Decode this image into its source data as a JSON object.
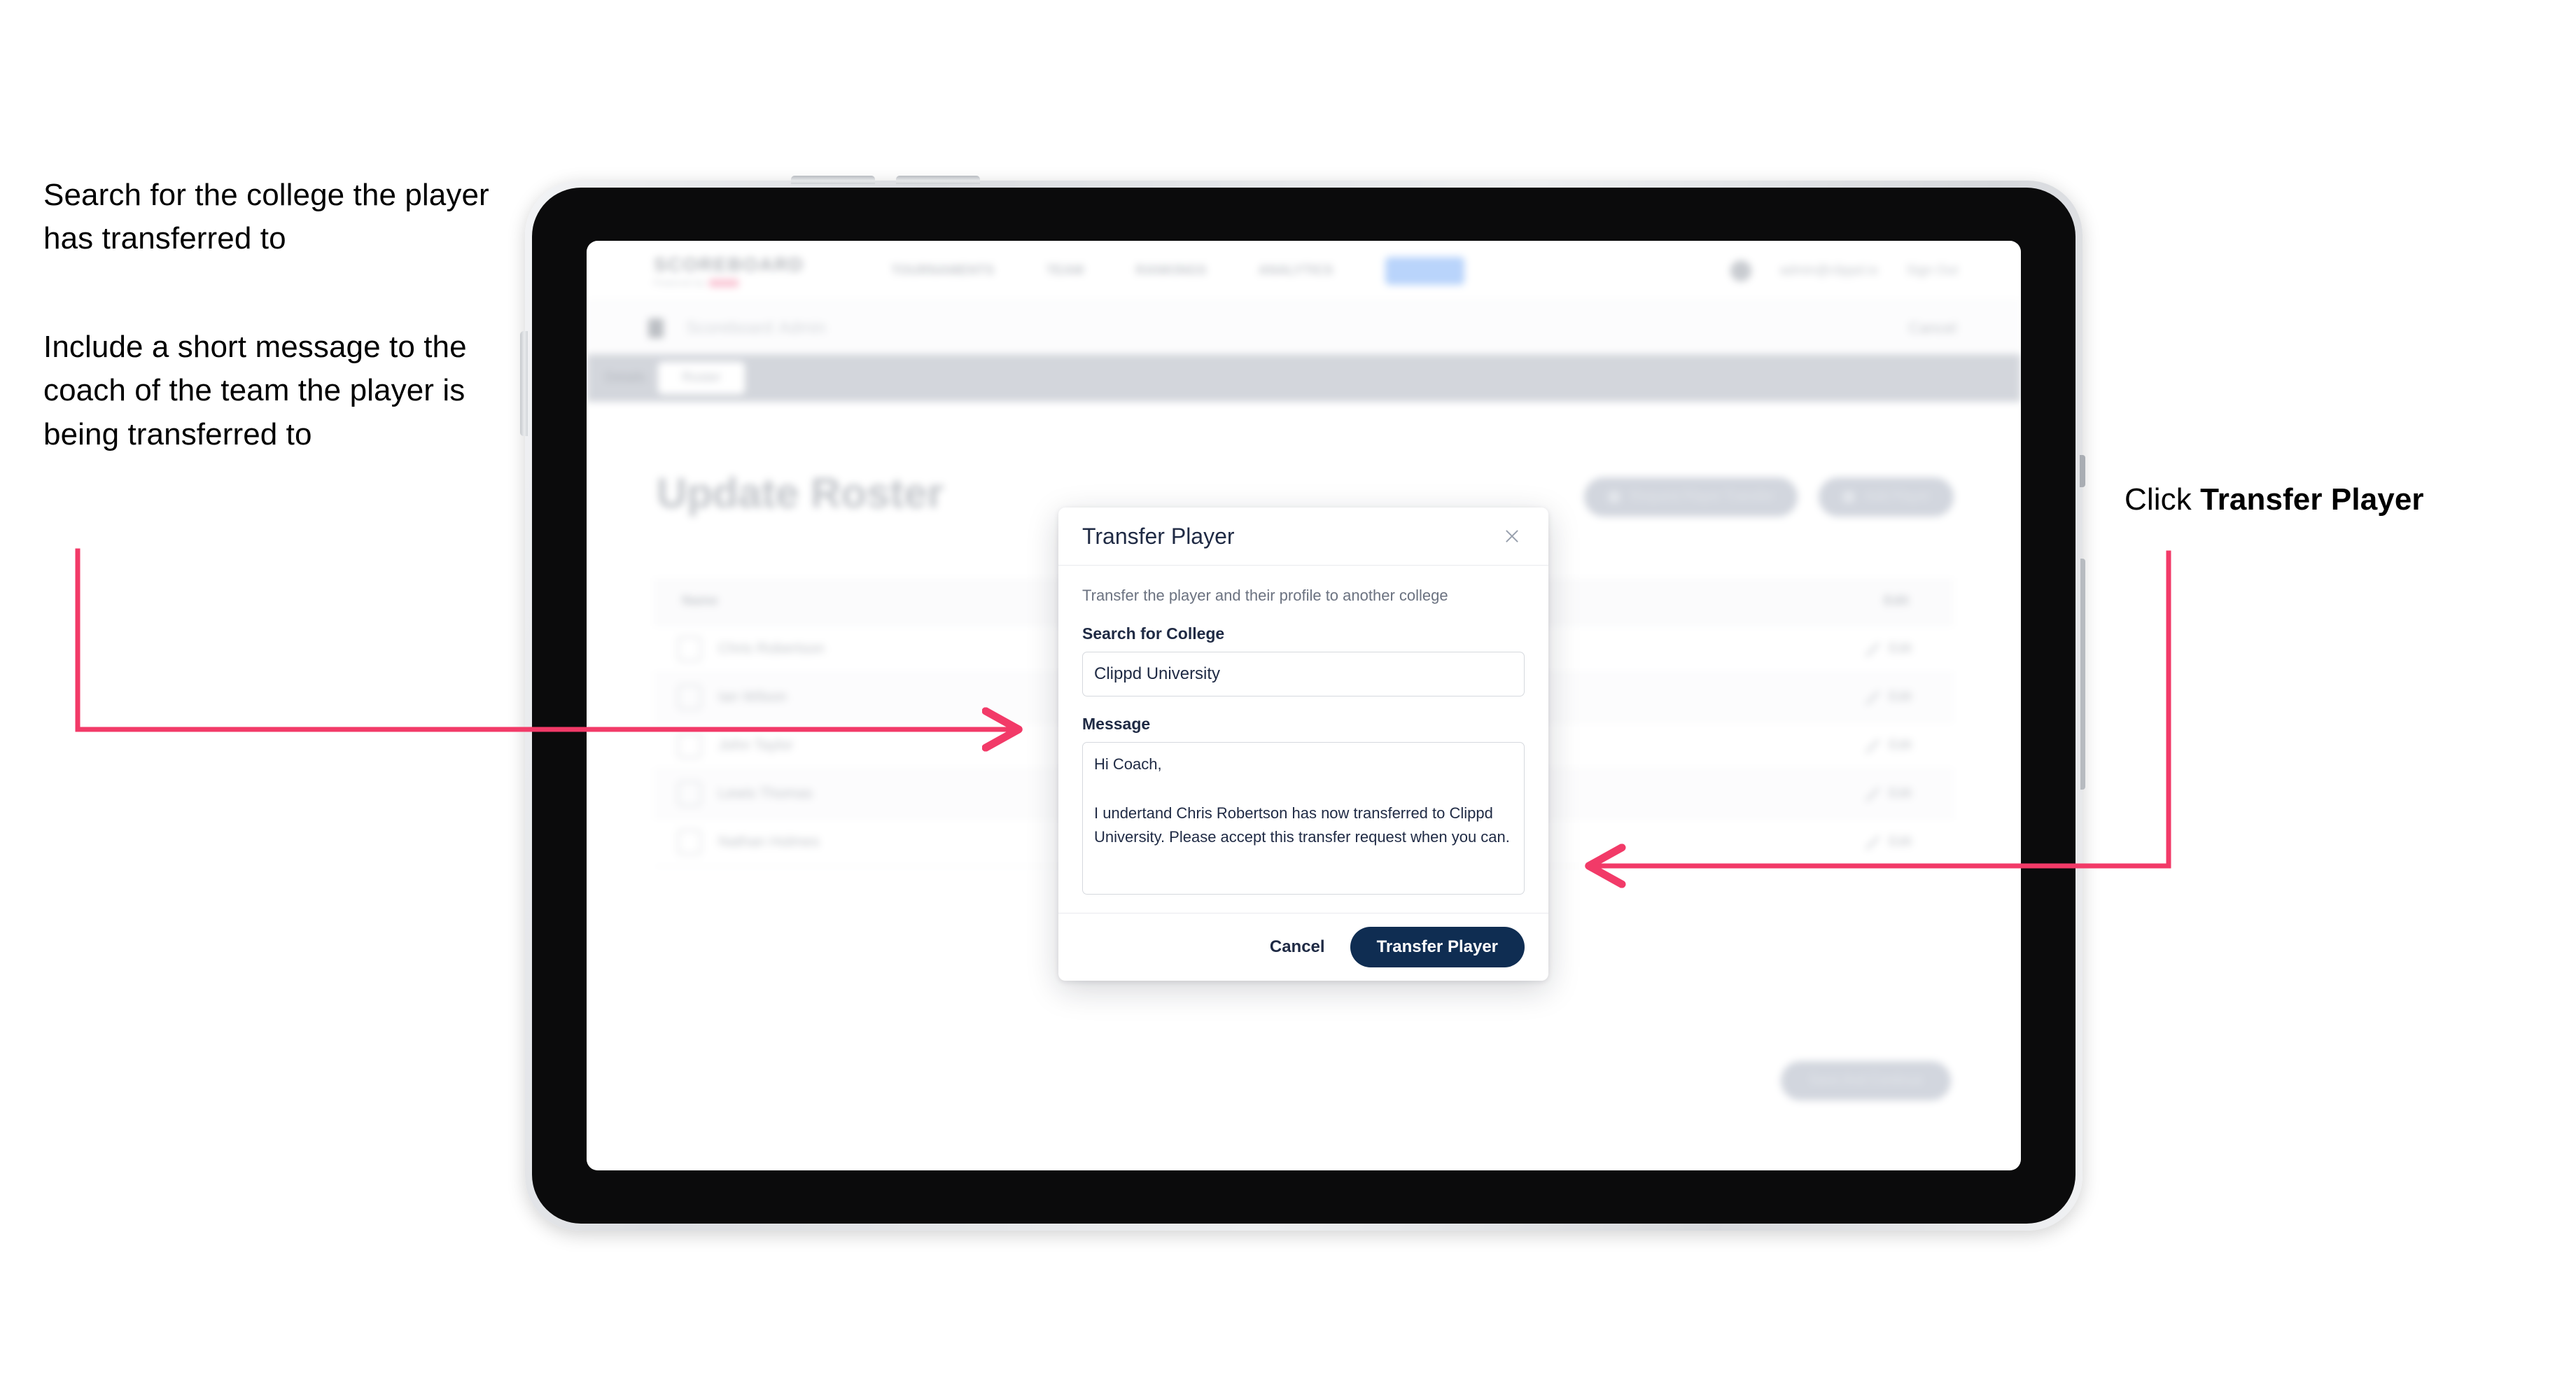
{
  "annotations": {
    "left_1": "Search for the college the player has transferred to",
    "left_2": "Include a short message to the coach of the team the player is being transferred to",
    "right_prefix": "Click ",
    "right_bold": "Transfer Player",
    "arrow_color": "#f23a68"
  },
  "app": {
    "brand": {
      "name": "SCOREBOARD",
      "sub": "Powered by"
    },
    "nav": {
      "links": [
        "TOURNAMENTS",
        "TEAM",
        "RANKINGS",
        "ANALYTICS"
      ],
      "pill": "ADMIN",
      "account_email": "admin@clippd.io",
      "sign_out": "Sign Out"
    },
    "subbar": {
      "title": "Scoreboard",
      "title_sub": "Admin",
      "right": "Cancel"
    },
    "tabs": [
      {
        "label": "Details",
        "active": false
      },
      {
        "label": "Roster",
        "active": true
      }
    ],
    "page_title": "Update Roster",
    "actions": [
      {
        "icon": "download-icon",
        "label": "Request Player Transfer"
      },
      {
        "icon": "plus-icon",
        "label": "Add Player"
      }
    ],
    "table": {
      "columns": [
        "Name",
        "Edit"
      ],
      "rows": [
        {
          "name": "Chris Robertson",
          "action": "Edit"
        },
        {
          "name": "Ian Wilson",
          "action": "Edit"
        },
        {
          "name": "John Taylor",
          "action": "Edit"
        },
        {
          "name": "Lewis Thomas",
          "action": "Edit"
        },
        {
          "name": "Nathan Holmes",
          "action": "Edit"
        }
      ]
    },
    "bottom_cta": "Save And Continue"
  },
  "modal": {
    "title": "Transfer Player",
    "close_icon": "close-icon",
    "description": "Transfer the player and their profile to another college",
    "college": {
      "label": "Search for College",
      "value": "Clippd University",
      "placeholder": "Search for College"
    },
    "message": {
      "label": "Message",
      "value": "Hi Coach,\n\nI undertand Chris Robertson has now transferred to Clippd University. Please accept this transfer request when you can.",
      "placeholder": "Message"
    },
    "cancel_label": "Cancel",
    "submit_label": "Transfer Player",
    "submit_color": "#0f2d52"
  }
}
